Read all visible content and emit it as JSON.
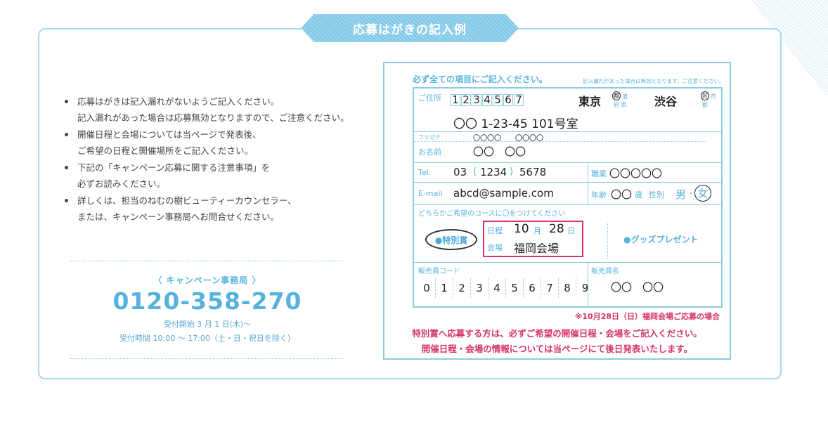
{
  "title": "応募はがきの記入例",
  "notes": [
    {
      "l1": "応募はがきは記入漏れがないようご記入ください。",
      "l2": "記入漏れがあった場合は応募無効となりますので、ご注意ください。"
    },
    {
      "l1": "開催日程と会場については当ページで発表後、",
      "l2": "ご希望の日程と開催場所をご記入ください。"
    },
    {
      "l1": "下記の「キャンペーン応募に関する注意事項」を",
      "l2": "必ずお読みください。"
    },
    {
      "l1": "詳しくは、担当のねむの樹ビューティーカウンセラー、",
      "l2": "または、キャンペーン事務局へお問合せください。"
    }
  ],
  "contact": {
    "office": "〈 キャンペーン事務局 〉",
    "phone": "0120-358-270",
    "start": "受付開始 3 月 1 日(木)〜",
    "hours": "受付時間 10:00 〜 17:00（土・日・祝日を除く）"
  },
  "card": {
    "heading": "必ず全ての項目にご記入ください。",
    "heading_note": "記入漏れがあった場合は無効となります。ご注意ください。",
    "address_label": "ご住所",
    "zip": [
      "1",
      "2",
      "3",
      "4",
      "5",
      "6",
      "7"
    ],
    "pref": "東京",
    "pref_suffix_top": "都",
    "pref_suffix_mid": "道",
    "pref_suffix_bot": "府 県",
    "city": "渋谷",
    "city_suffix_top": "区",
    "city_suffix_mid": "市",
    "city_suffix_bot": "郡",
    "address_line": "〇〇 1-23-45  101号室",
    "furigana_label": "フリガナ",
    "furigana": "〇〇〇〇　　〇〇〇〇",
    "name_label": "お名前",
    "name": "〇〇　〇〇",
    "tel_label": "Tel.",
    "tel_1": "03",
    "tel_2": "1234",
    "tel_3": "5678",
    "job_label": "職業",
    "job": "〇〇〇〇〇",
    "email_label": "E-mail",
    "email": "abcd@sample.com",
    "age_label": "年齢",
    "age": "〇〇",
    "age_unit": "歳",
    "gender_label": "性別",
    "gender_male": "男",
    "gender_dot": "・",
    "gender_female": "女",
    "course_label": "どちらかご希望のコースに〇をつけてください",
    "prize": "●特別賞",
    "date_label": "日程",
    "month": "10",
    "month_unit": "月",
    "day": "28",
    "day_unit": "日",
    "venue_label": "会場",
    "venue": "福岡会場",
    "goods": "●グッズプレゼント",
    "seller_code_label": "販売員コード",
    "seller_code": [
      "0",
      "1",
      "2",
      "3",
      "4",
      "5",
      "6",
      "7",
      "8",
      "9"
    ],
    "seller_name_label": "販売員名",
    "seller_name": "〇〇　〇〇",
    "fine_note": "※10月28日（日）福岡会場ご応募の場合",
    "warning_1": "特別賞へ応募する方は、必ずご希望の開催日程・会場をご記入ください。",
    "warning_2": "開催日程・会場の情報については当ページにて後日発表いたします。"
  },
  "colors": {
    "accent": "#56b2dd",
    "border": "#8ccbe7",
    "alert": "#d6336c"
  }
}
